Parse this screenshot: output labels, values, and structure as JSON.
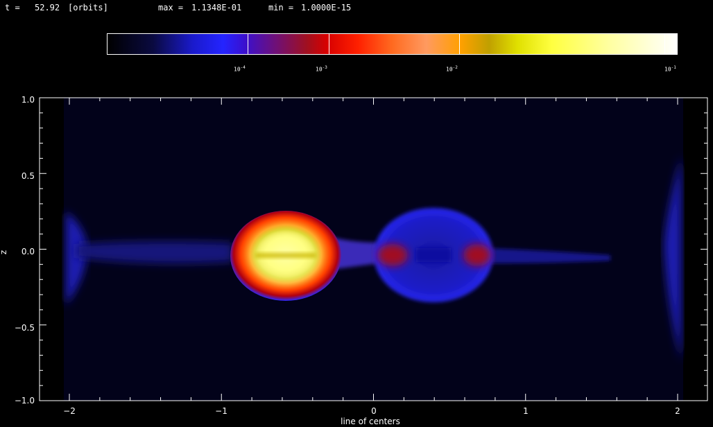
{
  "header": {
    "time_label": "t =",
    "time_value": "52.92",
    "time_unit": "[orbits]",
    "max_label": "max =",
    "max_value": "1.1348E-01",
    "min_label": "min =",
    "min_value": "1.0000E-15"
  },
  "colorbar": {
    "labels": [
      {
        "base": "10",
        "exp": "-4"
      },
      {
        "base": "10",
        "exp": "-3"
      },
      {
        "base": "10",
        "exp": "-2"
      },
      {
        "base": "10",
        "exp": "-1"
      }
    ],
    "colors": [
      "#000000",
      "#2424ff",
      "#d80000",
      "#ff9a60",
      "#ffff40",
      "#ffffff"
    ]
  },
  "plot": {
    "xlabel": "line of centers",
    "ylabel": "z",
    "xticks": [
      "−2",
      "−1",
      "0",
      "1",
      "2"
    ],
    "yticks": [
      "1.0",
      "0.5",
      "0.0",
      "−0.5",
      "−1.0"
    ],
    "background": "#02021a"
  },
  "chart_data": {
    "type": "heatmap",
    "title": "",
    "xlabel": "line of centers",
    "ylabel": "z",
    "xlim": [
      -2.2,
      2.2
    ],
    "ylim": [
      -1.0,
      1.0
    ],
    "x_ticks": [
      -2,
      -1,
      0,
      1,
      2
    ],
    "y_ticks": [
      1.0,
      0.5,
      0.0,
      -0.5,
      -1.0
    ],
    "colorbar_scale": "log",
    "colorbar_ticks": [
      0.0001,
      0.001,
      0.01,
      0.1
    ],
    "max": 0.11348,
    "min": 1e-15,
    "time_orbits": 52.92
  }
}
